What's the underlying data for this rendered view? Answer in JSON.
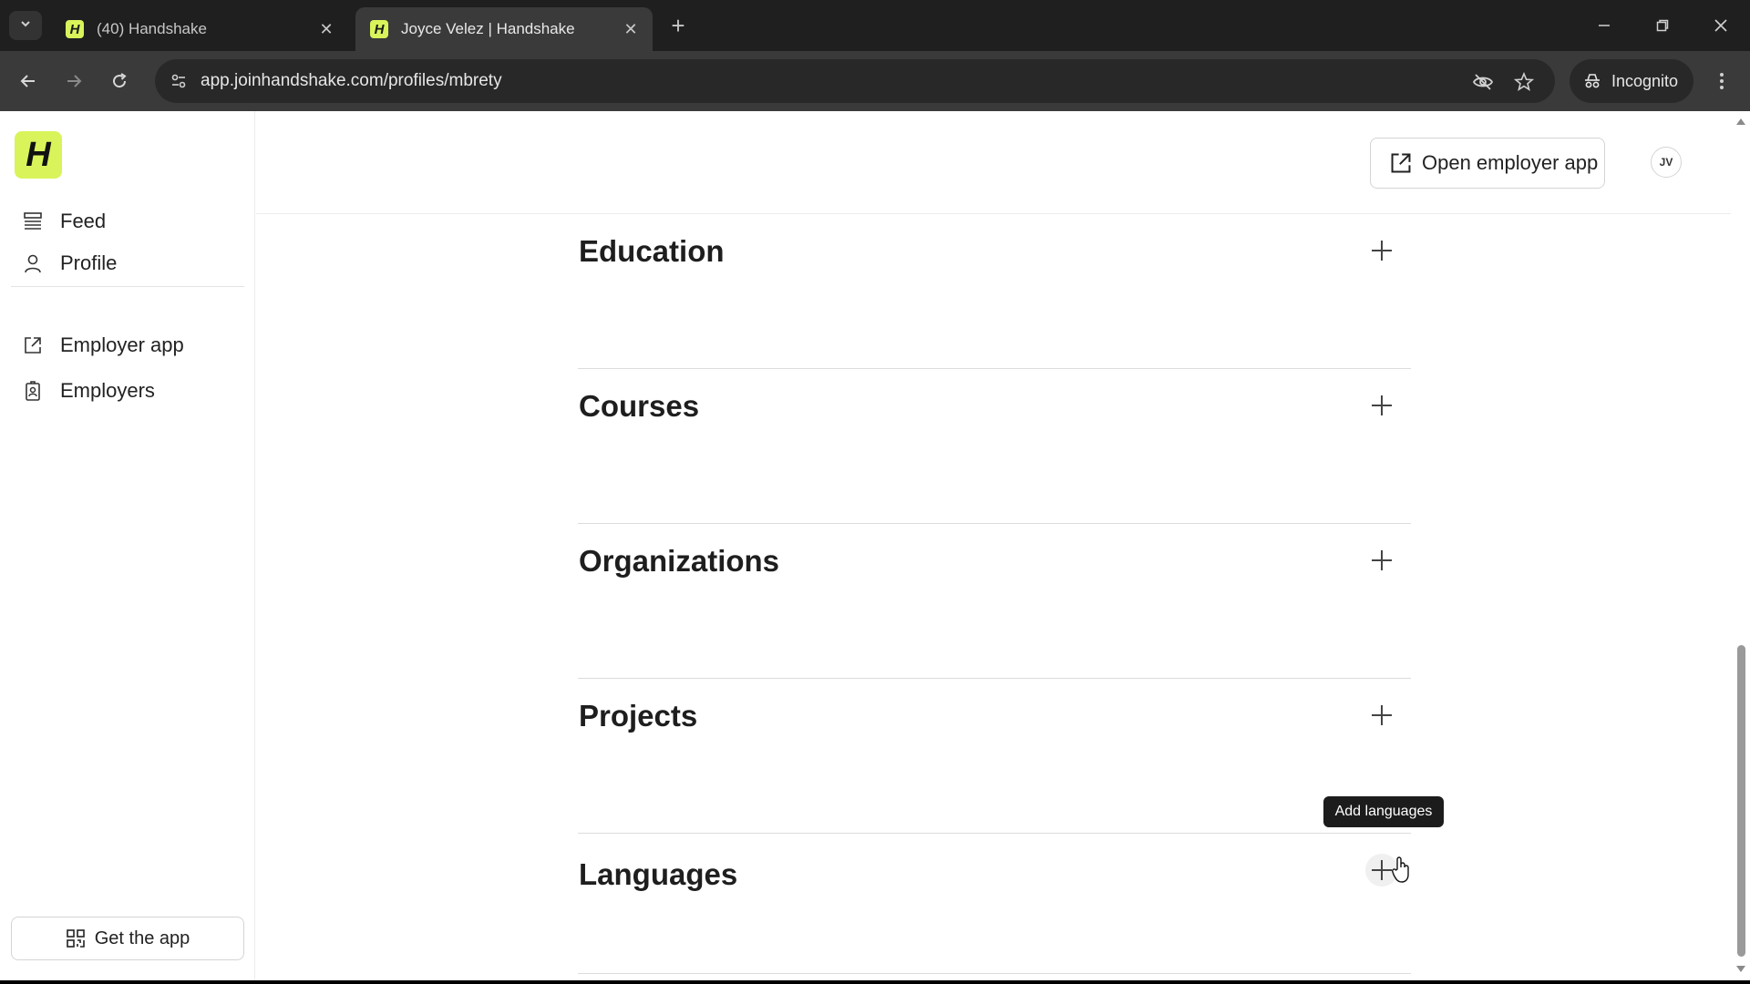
{
  "browser": {
    "tabs": [
      {
        "favicon": "H",
        "title": "(40) Handshake",
        "active": false
      },
      {
        "favicon": "H",
        "title": "Joyce Velez | Handshake",
        "active": true
      }
    ],
    "url": "app.joinhandshake.com/profiles/mbrety",
    "incognito_label": "Incognito",
    "icons": {
      "tab_search": "chevron-down-icon",
      "new_tab": "plus-icon",
      "back": "arrow-left-icon",
      "forward": "arrow-right-icon",
      "reload": "reload-icon",
      "site_info": "tune-icon",
      "eye_off": "eye-off-icon",
      "bookmark": "star-icon",
      "incognito": "incognito-icon",
      "menu": "kebab-icon"
    }
  },
  "sidebar": {
    "logo": "H",
    "items": [
      {
        "label": "Feed",
        "icon": "feed-icon"
      },
      {
        "label": "Profile",
        "icon": "person-icon"
      },
      {
        "label": "Employer app",
        "icon": "external-link-icon"
      },
      {
        "label": "Employers",
        "icon": "badge-icon"
      }
    ],
    "get_app_label": "Get the app"
  },
  "header": {
    "open_employer_label": "Open employer app",
    "avatar_initials": "JV"
  },
  "sections": [
    {
      "title": "Education"
    },
    {
      "title": "Courses"
    },
    {
      "title": "Organizations"
    },
    {
      "title": "Projects"
    },
    {
      "title": "Languages"
    }
  ],
  "tooltip": "Add languages",
  "colors": {
    "brand": "#d8f45a",
    "chrome_dark": "#1f1f1f",
    "chrome_toolbar": "#3a3a3a",
    "text_primary": "#1e1e1e"
  }
}
